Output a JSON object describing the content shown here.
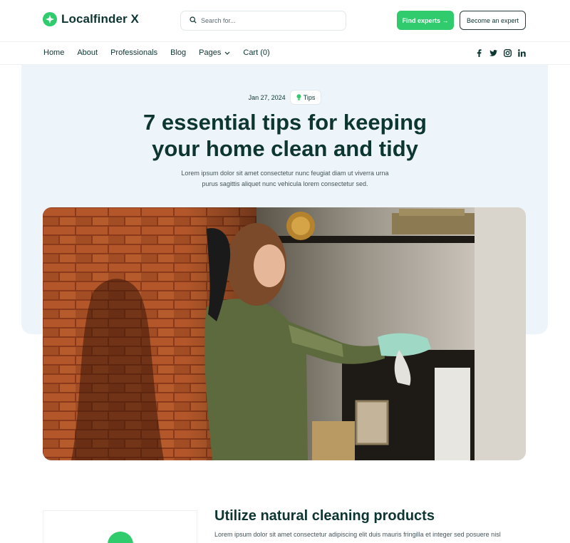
{
  "brand": {
    "name": "Localfinder X",
    "accent": "#2fcb6c",
    "dark": "#0d3532"
  },
  "search": {
    "placeholder": "Search for..."
  },
  "header_buttons": {
    "find": "Find experts →",
    "become": "Become an expert"
  },
  "nav": {
    "items": [
      {
        "label": "Home"
      },
      {
        "label": "About"
      },
      {
        "label": "Professionals"
      },
      {
        "label": "Blog"
      },
      {
        "label": "Pages",
        "dropdown": true
      },
      {
        "label": "Cart (0)"
      }
    ],
    "social": [
      "facebook-icon",
      "twitter-icon",
      "instagram-icon",
      "linkedin-icon"
    ]
  },
  "article": {
    "date": "Jan 27, 2024",
    "tag": "Tips",
    "title_line1": "7 essential tips for keeping",
    "title_line2": "your home clean and tidy",
    "subtitle": "Lorem ipsum dolor sit amet consectetur nunc feugiat diam ut viverra urna purus sagittis aliquet nunc vehicula lorem consectetur sed."
  },
  "section": {
    "title": "Utilize natural cleaning products",
    "text": "Lorem ipsum dolor sit amet consectetur adipiscing elit duis mauris fringilla et integer sed posuere nisl"
  }
}
